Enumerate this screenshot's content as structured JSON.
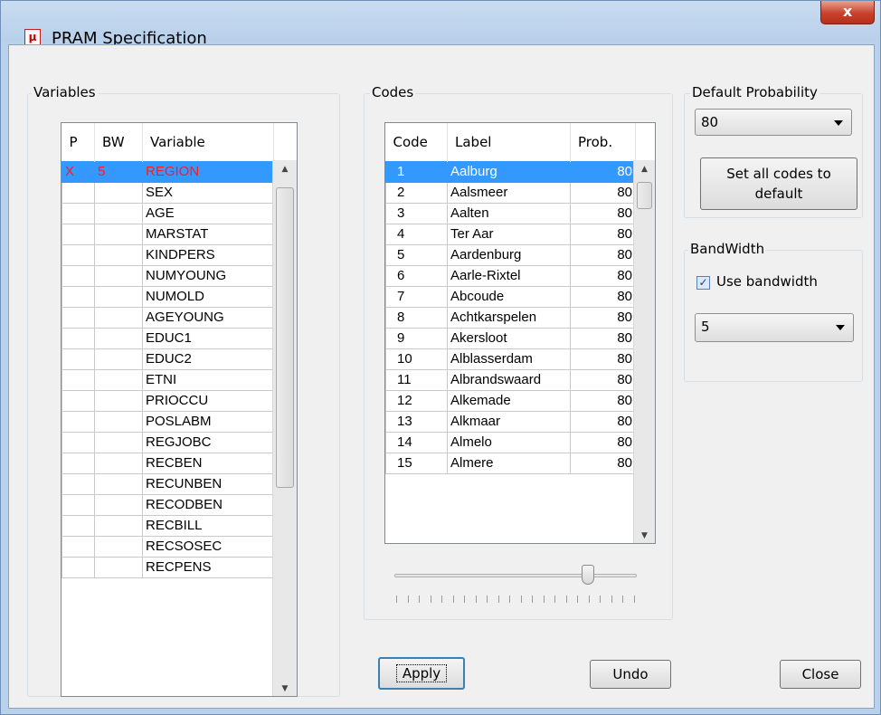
{
  "window": {
    "title": "PRAM Specification",
    "icon": "mu-icon",
    "close_glyph": "x"
  },
  "variables": {
    "group_label": "Variables",
    "columns": [
      "P",
      "BW",
      "Variable"
    ],
    "rows": [
      {
        "p": "X",
        "bw": "5",
        "name": "REGION"
      },
      {
        "p": "",
        "bw": "",
        "name": "SEX"
      },
      {
        "p": "",
        "bw": "",
        "name": "AGE"
      },
      {
        "p": "",
        "bw": "",
        "name": "MARSTAT"
      },
      {
        "p": "",
        "bw": "",
        "name": "KINDPERS"
      },
      {
        "p": "",
        "bw": "",
        "name": "NUMYOUNG"
      },
      {
        "p": "",
        "bw": "",
        "name": "NUMOLD"
      },
      {
        "p": "",
        "bw": "",
        "name": "AGEYOUNG"
      },
      {
        "p": "",
        "bw": "",
        "name": "EDUC1"
      },
      {
        "p": "",
        "bw": "",
        "name": "EDUC2"
      },
      {
        "p": "",
        "bw": "",
        "name": "ETNI"
      },
      {
        "p": "",
        "bw": "",
        "name": "PRIOCCU"
      },
      {
        "p": "",
        "bw": "",
        "name": "POSLABM"
      },
      {
        "p": "",
        "bw": "",
        "name": "REGJOBC"
      },
      {
        "p": "",
        "bw": "",
        "name": "RECBEN"
      },
      {
        "p": "",
        "bw": "",
        "name": "RECUNBEN"
      },
      {
        "p": "",
        "bw": "",
        "name": "RECODBEN"
      },
      {
        "p": "",
        "bw": "",
        "name": "RECBILL"
      },
      {
        "p": "",
        "bw": "",
        "name": "RECSOSEC"
      },
      {
        "p": "",
        "bw": "",
        "name": "RECPENS"
      }
    ]
  },
  "codes": {
    "group_label": "Codes",
    "columns": [
      "Code",
      "Label",
      "Prob."
    ],
    "rows": [
      {
        "code": "1",
        "label": "Aalburg",
        "prob": "80"
      },
      {
        "code": "2",
        "label": "Aalsmeer",
        "prob": "80"
      },
      {
        "code": "3",
        "label": "Aalten",
        "prob": "80"
      },
      {
        "code": "4",
        "label": "Ter Aar",
        "prob": "80"
      },
      {
        "code": "5",
        "label": "Aardenburg",
        "prob": "80"
      },
      {
        "code": "6",
        "label": "Aarle-Rixtel",
        "prob": "80"
      },
      {
        "code": "7",
        "label": "Abcoude",
        "prob": "80"
      },
      {
        "code": "8",
        "label": "Achtkarspelen",
        "prob": "80"
      },
      {
        "code": "9",
        "label": "Akersloot",
        "prob": "80"
      },
      {
        "code": "10",
        "label": "Alblasserdam",
        "prob": "80"
      },
      {
        "code": "11",
        "label": "Albrandswaard",
        "prob": "80"
      },
      {
        "code": "12",
        "label": "Alkemade",
        "prob": "80"
      },
      {
        "code": "13",
        "label": "Alkmaar",
        "prob": "80"
      },
      {
        "code": "14",
        "label": "Almelo",
        "prob": "80"
      },
      {
        "code": "15",
        "label": "Almere",
        "prob": "80"
      }
    ],
    "slider_value_fraction": 0.8
  },
  "default_probability": {
    "group_label": "Default Probability",
    "selected": "80",
    "set_all_label_line1": "Set all codes to",
    "set_all_label_line2": "default"
  },
  "bandwidth": {
    "group_label": "BandWidth",
    "use_bandwidth_label": "Use bandwidth",
    "use_bandwidth_checked": true,
    "check_glyph": "✓",
    "selected": "5"
  },
  "buttons": {
    "apply": "Apply",
    "undo": "Undo",
    "close": "Close"
  }
}
